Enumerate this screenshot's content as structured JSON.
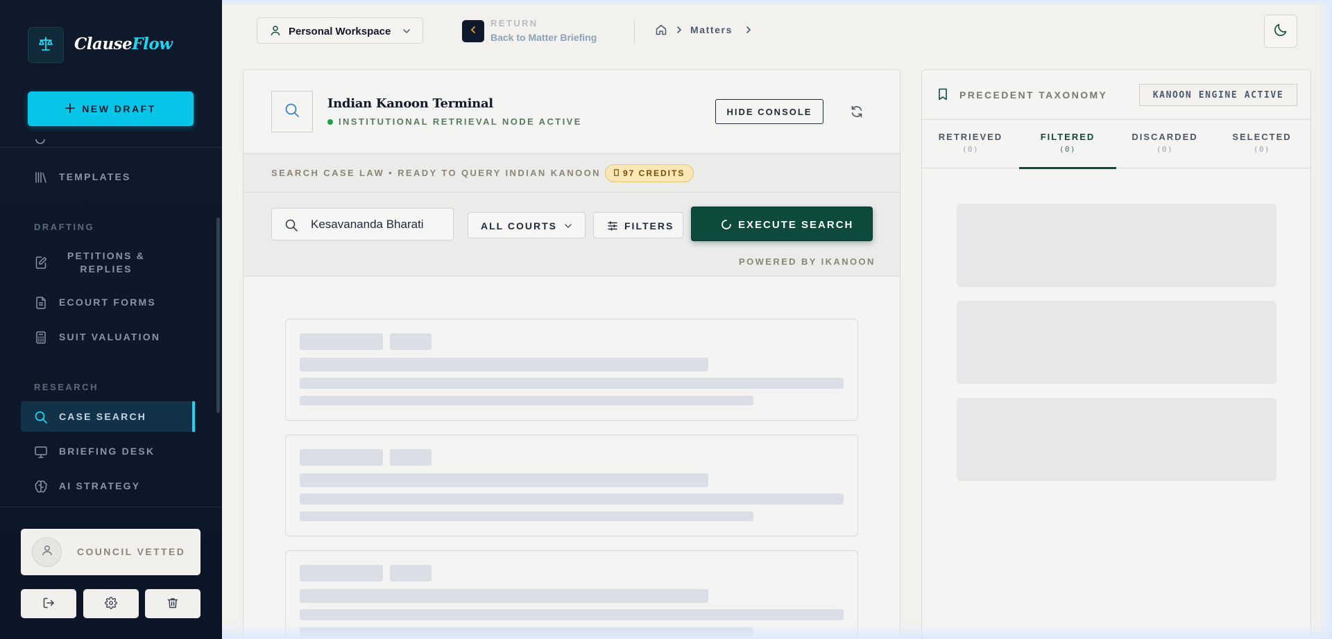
{
  "app": {
    "name_part1": "Clause",
    "name_part2": "Flow"
  },
  "sidebar": {
    "new_draft_label": "NEW DRAFT",
    "items_top": [
      {
        "label": "TEMPLATES",
        "icon": "library-icon"
      }
    ],
    "section_drafting": "DRAFTING",
    "items_drafting": [
      {
        "label": "PETITIONS & REPLIES",
        "icon": "edit-document-icon"
      },
      {
        "label": "ECOURT FORMS",
        "icon": "document-icon"
      },
      {
        "label": "SUIT VALUATION",
        "icon": "calculator-icon"
      }
    ],
    "section_research": "RESEARCH",
    "items_research": [
      {
        "label": "CASE SEARCH",
        "icon": "search-icon",
        "active": true
      },
      {
        "label": "BRIEFING DESK",
        "icon": "monitor-icon"
      },
      {
        "label": "AI STRATEGY",
        "icon": "brain-icon"
      }
    ],
    "council_label": "COUNCIL VETTED",
    "footer_buttons": [
      "logout-icon",
      "gear-icon",
      "trash-icon"
    ]
  },
  "topbar": {
    "workspace_label": "Personal Workspace",
    "return_label": "RETURN",
    "return_sub": "Back to Matter Briefing",
    "breadcrumb": "Matters"
  },
  "terminal": {
    "title": "Indian Kanoon Terminal",
    "status": "INSTITUTIONAL RETRIEVAL NODE ACTIVE",
    "hide_console_label": "HIDE CONSOLE",
    "strip_text": "SEARCH CASE LAW • READY TO QUERY INDIAN KANOON",
    "credits_label": "97 CREDITS",
    "search_value": "Kesavananda Bharati",
    "courts_label": "ALL COURTS",
    "filters_label": "FILTERS",
    "execute_label": "EXECUTE SEARCH",
    "powered_label": "POWERED BY IKANOON"
  },
  "taxonomy": {
    "title": "PRECEDENT TAXONOMY",
    "engine_badge": "KANOON ENGINE ACTIVE",
    "tabs": [
      {
        "label": "RETRIEVED",
        "count": "(0)"
      },
      {
        "label": "FILTERED",
        "count": "(0)",
        "active": true
      },
      {
        "label": "DISCARDED",
        "count": "(0)"
      },
      {
        "label": "SELECTED",
        "count": "(0)"
      }
    ]
  },
  "colors": {
    "accent": "#06c5e8",
    "primary_dark": "#0d4a3b",
    "sidebar_bg": "#0e1a2b",
    "status_green": "#16a34a"
  }
}
